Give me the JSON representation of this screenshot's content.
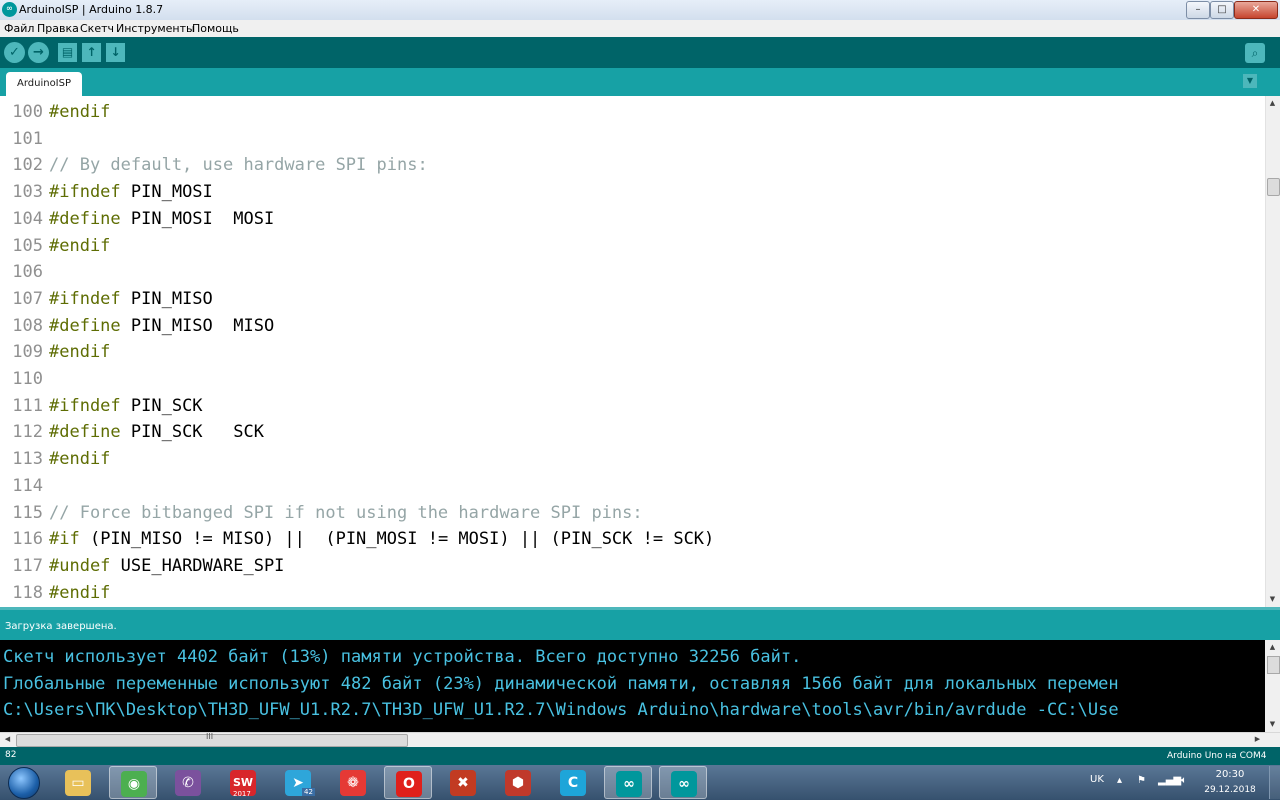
{
  "window": {
    "title": "ArduinoISP | Arduino 1.8.7",
    "app_icon_glyph": "∞",
    "controls": {
      "minimize": "–",
      "maximize": "□",
      "close": "✕"
    }
  },
  "menu": [
    "Файл",
    "Правка",
    "Скетч",
    "Инструменты",
    "Помощь"
  ],
  "toolbar": {
    "verify_icon": "✓",
    "upload_icon": "→",
    "new_icon": "▤",
    "open_icon": "↑",
    "save_icon": "↓",
    "serial_monitor_icon": "⌕"
  },
  "tabs": [
    {
      "label": "ArduinoISP"
    }
  ],
  "tab_menu_icon": "▼",
  "editor": {
    "lines": [
      {
        "num": "100",
        "directive": "#endif",
        "comment": "",
        "text": ""
      },
      {
        "num": "101",
        "directive": "",
        "comment": "",
        "text": ""
      },
      {
        "num": "102",
        "directive": "",
        "comment": "// By default, use hardware SPI pins:",
        "text": ""
      },
      {
        "num": "103",
        "directive": "#ifndef",
        "comment": "",
        "text": " PIN_MOSI"
      },
      {
        "num": "104",
        "directive": "#define",
        "comment": "",
        "text": " PIN_MOSI  MOSI"
      },
      {
        "num": "105",
        "directive": "#endif",
        "comment": "",
        "text": ""
      },
      {
        "num": "106",
        "directive": "",
        "comment": "",
        "text": ""
      },
      {
        "num": "107",
        "directive": "#ifndef",
        "comment": "",
        "text": " PIN_MISO"
      },
      {
        "num": "108",
        "directive": "#define",
        "comment": "",
        "text": " PIN_MISO  MISO"
      },
      {
        "num": "109",
        "directive": "#endif",
        "comment": "",
        "text": ""
      },
      {
        "num": "110",
        "directive": "",
        "comment": "",
        "text": ""
      },
      {
        "num": "111",
        "directive": "#ifndef",
        "comment": "",
        "text": " PIN_SCK"
      },
      {
        "num": "112",
        "directive": "#define",
        "comment": "",
        "text": " PIN_SCK   SCK"
      },
      {
        "num": "113",
        "directive": "#endif",
        "comment": "",
        "text": ""
      },
      {
        "num": "114",
        "directive": "",
        "comment": "",
        "text": ""
      },
      {
        "num": "115",
        "directive": "",
        "comment": "// Force bitbanged SPI if not using the hardware SPI pins:",
        "text": ""
      },
      {
        "num": "116",
        "directive": "#if",
        "comment": "",
        "text": " (PIN_MISO != MISO) ||  (PIN_MOSI != MOSI) || (PIN_SCK != SCK)"
      },
      {
        "num": "117",
        "directive": "#undef",
        "comment": "",
        "text": " USE_HARDWARE_SPI"
      },
      {
        "num": "118",
        "directive": "#endif",
        "comment": "",
        "text": ""
      }
    ]
  },
  "scroll_arrows": {
    "up": "▲",
    "down": "▼",
    "left": "◀",
    "right": "▶",
    "grip": "III"
  },
  "status": {
    "message": "Загрузка завершена."
  },
  "console": {
    "lines": [
      "Скетч использует 4402 байт (13%) памяти устройства. Всего доступно 32256 байт.",
      "Глобальные переменные используют 482 байт (23%) динамической памяти, оставляя 1566 байт для локальных перемен",
      "C:\\Users\\ПК\\Desktop\\TH3D_UFW_U1.R2.7\\TH3D_UFW_U1.R2.7\\Windows Arduino\\hardware\\tools\\avr/bin/avrdude -CC:\\Use"
    ]
  },
  "footer": {
    "line_number": "82",
    "board": "Arduino Uno на COM4"
  },
  "taskbar": {
    "apps": [
      {
        "name": "explorer",
        "glyph": "▭",
        "color": "#e8c15a",
        "active": false
      },
      {
        "name": "chrome",
        "glyph": "◉",
        "color": "#4caf50",
        "active": true
      },
      {
        "name": "viber",
        "glyph": "✆",
        "color": "#7b519d",
        "active": false
      },
      {
        "name": "solidworks",
        "glyph": "SW",
        "color": "#d8262b",
        "active": false
      },
      {
        "name": "telegram",
        "glyph": "➤",
        "color": "#2ea6da",
        "active": false
      },
      {
        "name": "camera-app",
        "glyph": "❁",
        "color": "#e53935",
        "active": false
      },
      {
        "name": "opera",
        "glyph": "O",
        "color": "#e0201b",
        "active": true
      },
      {
        "name": "inkscape",
        "glyph": "✖",
        "color": "#c23b22",
        "active": false
      },
      {
        "name": "3d-app",
        "glyph": "⬢",
        "color": "#c0392b",
        "active": false
      },
      {
        "name": "ccleaner",
        "glyph": "C",
        "color": "#1ea5d9",
        "active": false
      },
      {
        "name": "arduino-1",
        "glyph": "∞",
        "color": "#00979c",
        "active": true
      },
      {
        "name": "arduino-2",
        "glyph": "∞",
        "color": "#00979c",
        "active": true
      }
    ],
    "badge": "42",
    "sw_year": "2017",
    "tray": {
      "lang": "UK",
      "time": "20:30",
      "date": "29.12.2018"
    }
  }
}
